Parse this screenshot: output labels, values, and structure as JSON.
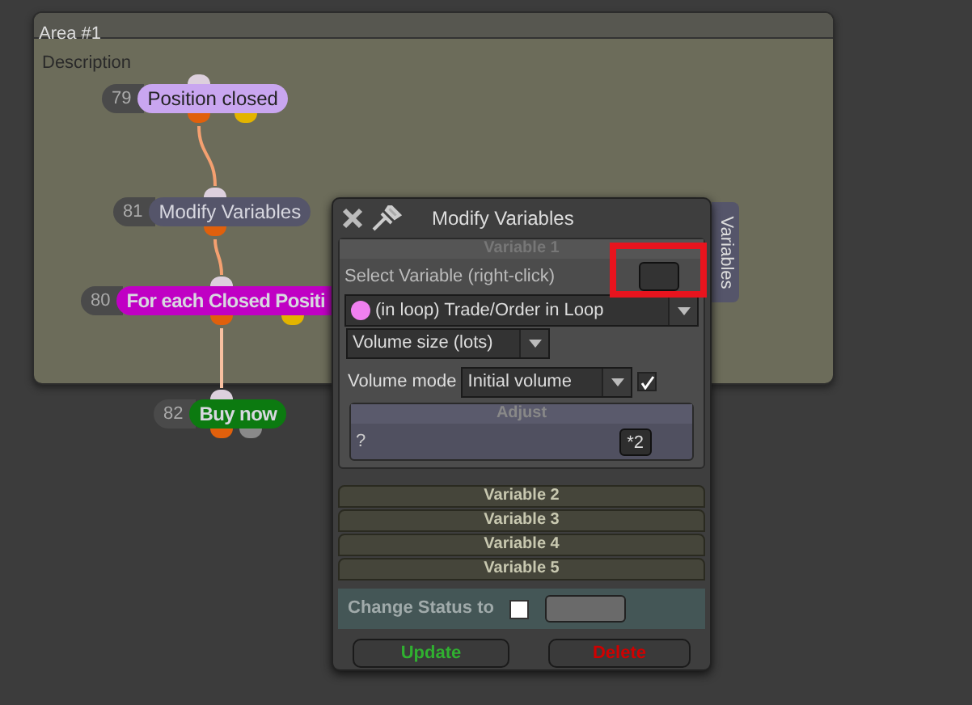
{
  "area": {
    "title": "Area #1",
    "description": "Description"
  },
  "nodes": [
    {
      "number": "79",
      "label": "Position closed",
      "color": "#c9a6f0",
      "bold": false
    },
    {
      "number": "81",
      "label": "Modify Variables",
      "color": "#55556a",
      "bold": false
    },
    {
      "number": "80",
      "label": "For each Closed Positi",
      "color": "#c000c4",
      "bold": true
    },
    {
      "number": "82",
      "label": "Buy now",
      "color": "#0c7a10",
      "bold": true
    }
  ],
  "dialog": {
    "title": "Modify Variables",
    "side_tab": "Variables",
    "sections": [
      {
        "title": "Variable 1",
        "expanded": true
      },
      {
        "title": "Variable 2",
        "expanded": false
      },
      {
        "title": "Variable 3",
        "expanded": false
      },
      {
        "title": "Variable 4",
        "expanded": false
      },
      {
        "title": "Variable 5",
        "expanded": false
      }
    ],
    "select_label": "Select Variable (right-click)",
    "variable_dropdown": {
      "value": "(in loop) Trade/Order in Loop",
      "color": "#f080f0"
    },
    "property_dropdown": "Volume size (lots)",
    "volume_mode": {
      "label": "Volume mode",
      "value": "Initial volume",
      "checked": true
    },
    "adjust": {
      "title": "Adjust",
      "value": "?",
      "button": "*2"
    },
    "change_status": {
      "label": "Change Status to",
      "checked": false
    },
    "buttons": [
      {
        "label": "Update",
        "kind": "update"
      },
      {
        "label": "Delete",
        "kind": "delete"
      }
    ]
  }
}
